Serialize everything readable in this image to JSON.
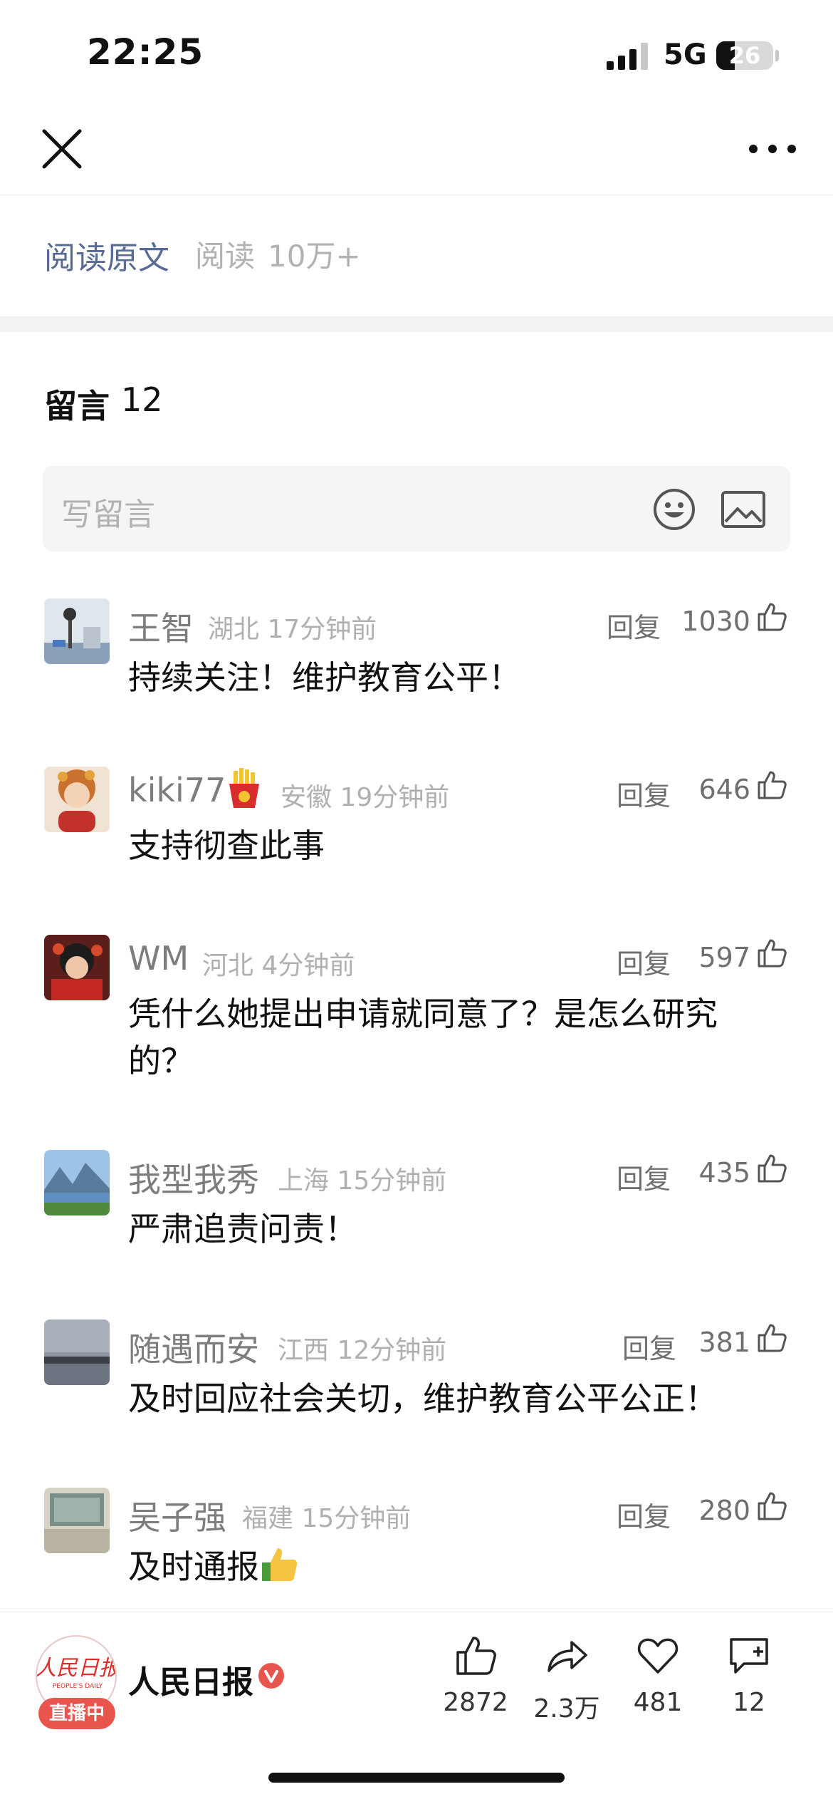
{
  "status_bar": {
    "time": "22:25",
    "network": "5G",
    "battery": "26"
  },
  "nav": {
    "close_icon": "close-icon",
    "more_icon": "more-horizontal-icon"
  },
  "article": {
    "read_original": "阅读原文",
    "read_label": "阅读",
    "read_count": "10万+"
  },
  "comments": {
    "title": "留言",
    "count": "12",
    "write_placeholder": "写留言",
    "items": [
      {
        "name": "王智",
        "location": "湖北",
        "time": "17分钟前",
        "reply": "回复",
        "likes": "1030",
        "text": "持续关注！维护教育公平！"
      },
      {
        "name": "kiki77",
        "location": "安徽",
        "time": "19分钟前",
        "reply": "回复",
        "likes": "646",
        "text": "支持彻查此事"
      },
      {
        "name": "WM",
        "location": "河北",
        "time": "4分钟前",
        "reply": "回复",
        "likes": "597",
        "text": "凭什么她提出申请就同意了？是怎么研究的？"
      },
      {
        "name": "我型我秀",
        "location": "上海",
        "time": "15分钟前",
        "reply": "回复",
        "likes": "435",
        "text": "严肃追责问责！"
      },
      {
        "name": "随遇而安",
        "location": "江西",
        "time": "12分钟前",
        "reply": "回复",
        "likes": "381",
        "text": "及时回应社会关切，维护教育公平公正！"
      },
      {
        "name": "吴子强",
        "location": "福建",
        "time": "15分钟前",
        "reply": "回复",
        "likes": "280",
        "text": "及时通报"
      }
    ]
  },
  "bottom_bar": {
    "account_name": "人民日报",
    "logo_text": "人民日报",
    "logo_sub": "PEOPLE'S DAILY",
    "live_badge": "直播中",
    "likes": "2872",
    "shares": "2.3万",
    "favorites": "481",
    "comments": "12"
  },
  "colors": {
    "link": "#576b95",
    "muted": "#b2b2b2",
    "live": "#e8554d",
    "verified": "#e8554d"
  }
}
